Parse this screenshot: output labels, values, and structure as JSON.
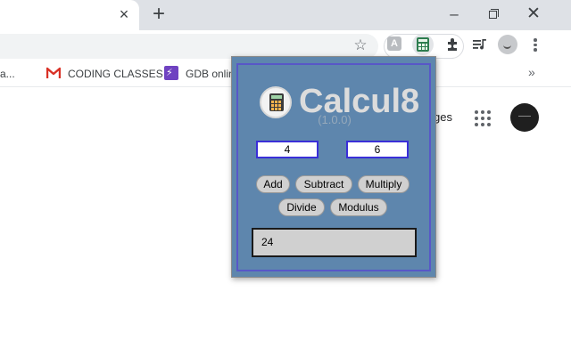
{
  "window": {
    "tab_close_glyph": "×",
    "new_tab_glyph": "+",
    "minimize_glyph": "–",
    "close_glyph": "✕"
  },
  "toolbar": {
    "star_glyph": "☆",
    "extensions": [
      "extension-a-icon",
      "calculator-icon",
      "puzzle-icon",
      "playlist-icon",
      "profile-icon",
      "menu-dots-icon"
    ]
  },
  "bookmarks": {
    "first": "a...",
    "items": [
      {
        "icon": "gmail-icon",
        "label": "CODING CLASSES"
      },
      {
        "icon": "gdb-icon",
        "label": "GDB onlin"
      }
    ],
    "overflow_glyph": "»"
  },
  "page": {
    "partial_text": "ges"
  },
  "calcul8": {
    "title": "Calcul8",
    "version": "(1.0.0)",
    "input_a": "4",
    "input_b": "6",
    "buttons": {
      "add": "Add",
      "subtract": "Subtract",
      "multiply": "Multiply",
      "divide": "Divide",
      "modulus": "Modulus"
    },
    "result": "24",
    "colors": {
      "panel": "#5e86ad",
      "border": "#5857c8",
      "input_border": "#3a2fd8"
    }
  }
}
